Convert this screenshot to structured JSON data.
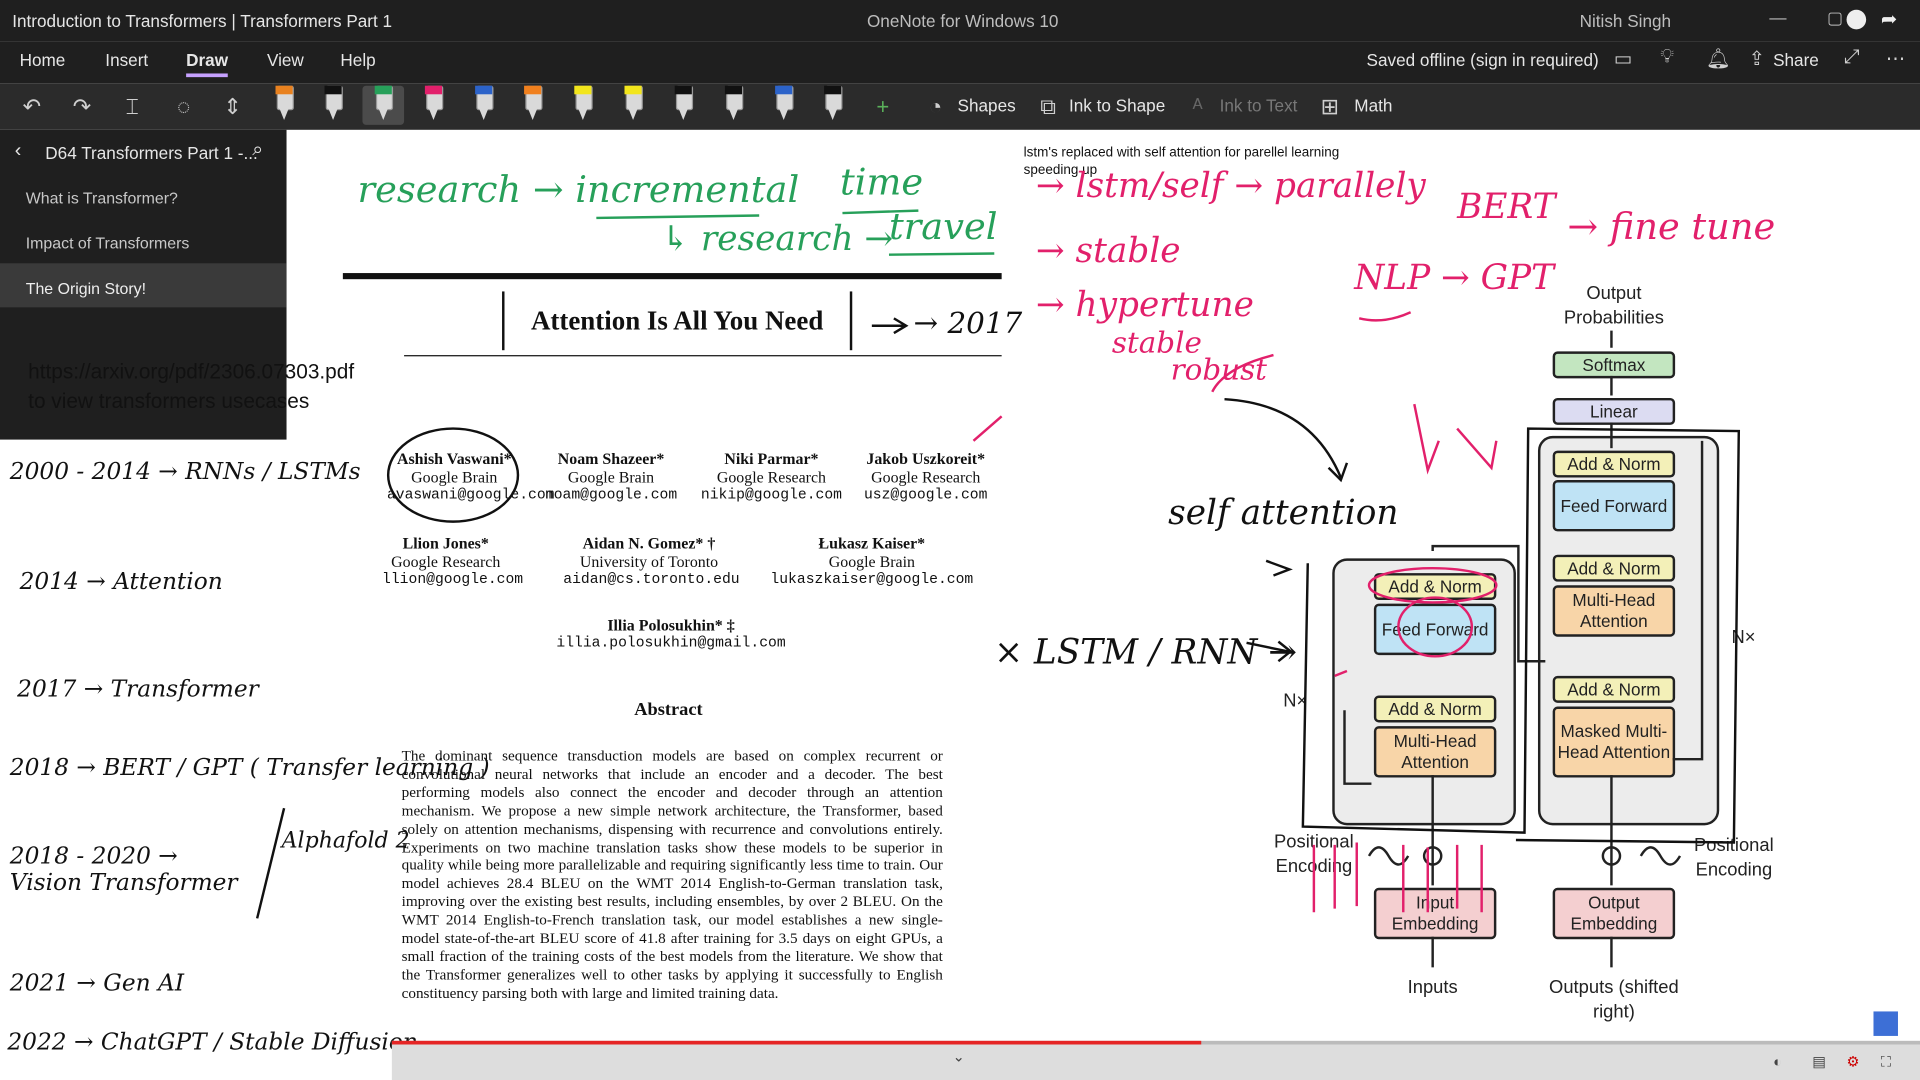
{
  "window": {
    "title": "Introduction to Transformers | Transformers Part 1",
    "app_name": "OneNote for Windows 10",
    "user": "Nitish Singh"
  },
  "menu": {
    "items": [
      "Home",
      "Insert",
      "Draw",
      "View",
      "Help"
    ],
    "active": "Draw",
    "status": "Saved offline (sign in required)",
    "share_label": "Share"
  },
  "toolbar": {
    "shapes_label": "Shapes",
    "ink_to_shape_label": "Ink to Shape",
    "ink_to_text_label": "Ink to Text",
    "math_label": "Math",
    "pens": [
      {
        "color": "#e8811f",
        "type": "highlighter-black"
      },
      {
        "color": "#111111",
        "type": "pen"
      },
      {
        "color": "#27a05a",
        "type": "pen"
      },
      {
        "color": "#e2206b",
        "type": "pen"
      },
      {
        "color": "#2c63c9",
        "type": "pen"
      },
      {
        "color": "#f0801e",
        "type": "pen"
      },
      {
        "color": "#f2e51c",
        "type": "pen"
      },
      {
        "color": "#f2e51c",
        "type": "highlighter"
      },
      {
        "color": "#111111",
        "type": "pen-wide"
      },
      {
        "color": "#111111",
        "type": "pen-heart"
      },
      {
        "color": "#2c63c9",
        "type": "pen"
      },
      {
        "color": "#111111",
        "type": "pen"
      }
    ]
  },
  "sidebar": {
    "section_title": "D64 Transformers Part 1 -...",
    "pages": [
      "What is Transformer?",
      "Impact of Transformers",
      "The Origin Story!"
    ],
    "selected_page": "The Origin Story!"
  },
  "note": {
    "url_line1": "https://arxiv.org/pdf/2306.07303.pdf",
    "url_line2": "to view transformers usecases",
    "timeline": [
      "2000 - 2014 → RNNs / LSTMs",
      "2014 → Attention",
      "2017 → Transformer",
      "2018 → BERT / GPT ( Transfer learning )",
      "2018 - 2020 → Vision Transformer",
      "Alphafold 2",
      "2021 → Gen AI",
      "2022 → ChatGPT / Stable Diffusion"
    ]
  },
  "handwriting": {
    "top1": "research → incremental",
    "top2": "time",
    "top3": "↳ research →",
    "top4": "travel",
    "year": "→ 2017",
    "r1": "→ lstm/self → parallely",
    "r2": "→ stable",
    "r3": "→ hypertune",
    "r4": "stable",
    "r5": "robust",
    "bert": "BERT",
    "gpt": "NLP → GPT",
    "finetune": "→ fine tune",
    "self_attention": "self attention",
    "lstm": "× LSTM / RNN →"
  },
  "paper": {
    "title": "Attention Is All You Need",
    "authors": [
      {
        "name": "Ashish Vaswani*",
        "org": "Google Brain",
        "email": "avaswani@google.com"
      },
      {
        "name": "Noam Shazeer*",
        "org": "Google Brain",
        "email": "noam@google.com"
      },
      {
        "name": "Niki Parmar*",
        "org": "Google Research",
        "email": "nikip@google.com"
      },
      {
        "name": "Jakob Uszkoreit*",
        "org": "Google Research",
        "email": "usz@google.com"
      },
      {
        "name": "Llion Jones*",
        "org": "Google Research",
        "email": "llion@google.com"
      },
      {
        "name": "Aidan N. Gomez* †",
        "org": "University of Toronto",
        "email": "aidan@cs.toronto.edu"
      },
      {
        "name": "Łukasz Kaiser*",
        "org": "Google Brain",
        "email": "lukaszkaiser@google.com"
      },
      {
        "name": "Illia Polosukhin* ‡",
        "org": "",
        "email": "illia.polosukhin@gmail.com"
      }
    ],
    "abstract_heading": "Abstract",
    "abstract": "The dominant sequence transduction models are based on complex recurrent or convolutional neural networks that include an encoder and a decoder. The best performing models also connect the encoder and decoder through an attention mechanism. We propose a new simple network architecture, the Transformer, based solely on attention mechanisms, dispensing with recurrence and convolutions entirely. Experiments on two machine translation tasks show these models to be superior in quality while being more parallelizable and requiring significantly less time to train. Our model achieves 28.4 BLEU on the WMT 2014 English-to-German translation task, improving over the existing best results, including ensembles, by over 2 BLEU. On the WMT 2014 English-to-French translation task, our model establishes a new single-model state-of-the-art BLEU score of 41.8 after training for 3.5 days on eight GPUs, a small fraction of the training costs of the best models from the literature. We show that the Transformer generalizes well to other tasks by applying it successfully to English constituency parsing both with large and limited training data."
  },
  "annotation": {
    "line1": "lstm's replaced with self attention for parellel learning",
    "line2": "speeding up"
  },
  "diagram": {
    "output_probabilities": "Output Probabilities",
    "softmax": "Softmax",
    "linear": "Linear",
    "add_norm": "Add & Norm",
    "feed_forward": "Feed Forward",
    "multi_head_attention": "Multi-Head Attention",
    "masked_mha": "Masked Multi-Head Attention",
    "nx": "N×",
    "positional_encoding": "Positional Encoding",
    "input_embedding": "Input Embedding",
    "output_embedding": "Output Embedding",
    "inputs": "Inputs",
    "outputs": "Outputs (shifted right)"
  },
  "video": {
    "progress": 0.53
  }
}
